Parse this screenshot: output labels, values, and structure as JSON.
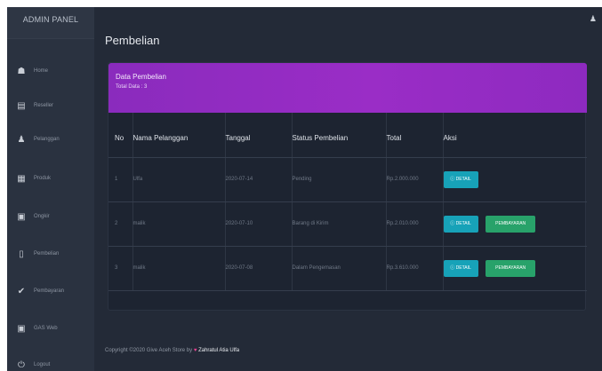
{
  "sidebar": {
    "brand": "ADMIN PANEL",
    "items": [
      {
        "label": "Home",
        "icon": "home-icon"
      },
      {
        "label": "Reseller",
        "icon": "id-card-icon"
      },
      {
        "label": "Pelanggan",
        "icon": "user-icon"
      },
      {
        "label": "Produk",
        "icon": "product-icon"
      },
      {
        "label": "Ongkir",
        "icon": "truck-icon"
      },
      {
        "label": "Pembelian",
        "icon": "document-icon"
      },
      {
        "label": "Pembayaran",
        "icon": "check-icon"
      },
      {
        "label": "GAS Web",
        "icon": "monitor-icon"
      },
      {
        "label": "Logout",
        "icon": "power-icon"
      }
    ]
  },
  "header": {
    "title": "Pembelian",
    "user_icon": "user-icon"
  },
  "card": {
    "title": "Data Pembelian",
    "subtitle": "Total Data : 3",
    "accent_color": "#9a2dc6"
  },
  "table": {
    "headers": [
      "No",
      "Nama Pelanggan",
      "Tanggal",
      "Status Pembelian",
      "Total",
      "Aksi"
    ],
    "rows": [
      {
        "no": "1",
        "nama": "Ulfa",
        "tanggal": "2020-07-14",
        "status": "Pending",
        "total": "Rp.2.000.000",
        "detail": "DETAIL",
        "bayar": null
      },
      {
        "no": "2",
        "nama": "malik",
        "tanggal": "2020-07-10",
        "status": "Barang di Kirim",
        "total": "Rp.2.010.000",
        "detail": "DETAIL",
        "bayar": "PEMBAYARAN"
      },
      {
        "no": "3",
        "nama": "malik",
        "tanggal": "2020-07-08",
        "status": "Dalam Pengemasan",
        "total": "Rp.3.610.000",
        "detail": "DETAIL",
        "bayar": "PEMBAYARAN"
      }
    ]
  },
  "footer": {
    "prefix": "Copyright ©2020 Give Aceh Store by",
    "heart": "♥",
    "author": "Zahratul Atia Ulfa"
  }
}
